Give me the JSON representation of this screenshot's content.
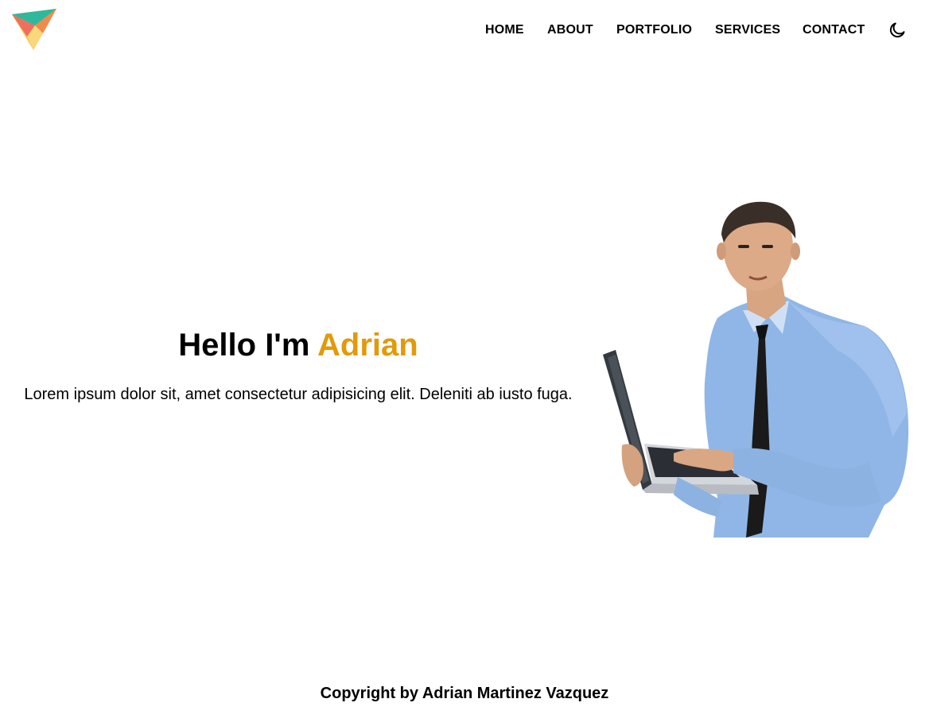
{
  "header": {
    "logo_icon": "triangle-logo-icon",
    "nav": [
      {
        "label": "HOME"
      },
      {
        "label": "ABOUT"
      },
      {
        "label": "PORTFOLIO"
      },
      {
        "label": "SERVICES"
      },
      {
        "label": "CONTACT"
      }
    ],
    "theme_toggle_icon": "moon-icon"
  },
  "hero": {
    "greeting": "Hello I'm",
    "name": "Adrian",
    "subtitle": "Lorem ipsum dolor sit, amet consectetur adipisicing elit. Deleniti ab iusto fuga.",
    "accent_color": "#e29a0b"
  },
  "footer": {
    "copyright": "Copyright by Adrian Martinez Vazquez"
  }
}
